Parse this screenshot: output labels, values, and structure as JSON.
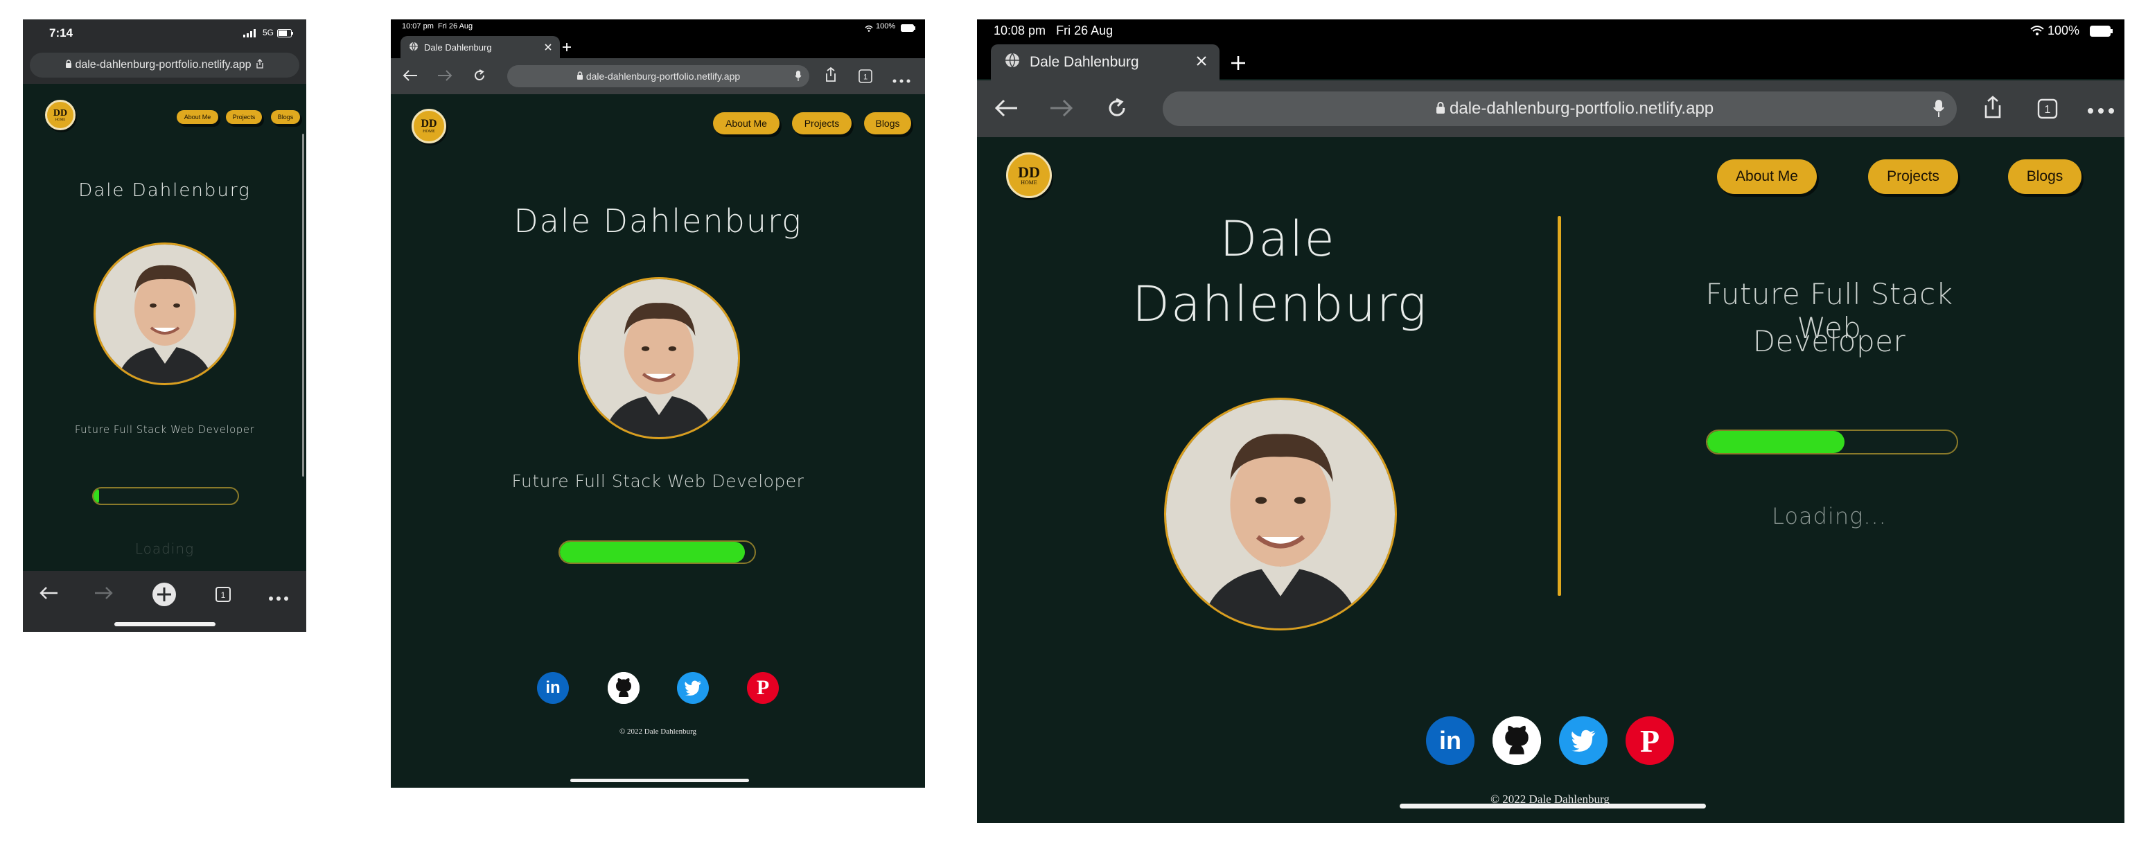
{
  "site": {
    "url": "dale-dahlenburg-portfolio.netlify.app",
    "tab_title": "Dale Dahlenburg",
    "logo_text": "DD",
    "logo_subtext": "HOME",
    "nav": [
      "About Me",
      "Projects",
      "Blogs"
    ],
    "name": "Dale Dahlenburg",
    "name_line1": "Dale",
    "name_line2": "Dahlenburg",
    "subtitle": "Future Full Stack Web Developer",
    "subtitle_line1": "Future Full Stack Web",
    "subtitle_line2": "Developer",
    "loading_text": "Loading...",
    "loading_text_phone": "Loading",
    "footer": "© 2022 Dale Dahlenburg",
    "social": [
      "linkedin-icon",
      "github-icon",
      "twitter-icon",
      "pinterest-icon"
    ]
  },
  "phone": {
    "time": "7:14",
    "network": "5G",
    "progress": 0.04
  },
  "tablet_portrait": {
    "time": "10:07 pm",
    "date": "Fri 26 Aug",
    "battery": "100%",
    "progress": 0.95
  },
  "tablet_landscape": {
    "time": "10:08 pm",
    "date": "Fri 26 Aug",
    "battery": "100%",
    "progress": 0.55
  },
  "colors": {
    "page_bg": "#0d1f1b",
    "accent": "#e0a91f",
    "progress": "#33dd1c",
    "linkedin": "#0a66c2",
    "twitter": "#1d9bf0",
    "pinterest": "#e60023"
  }
}
